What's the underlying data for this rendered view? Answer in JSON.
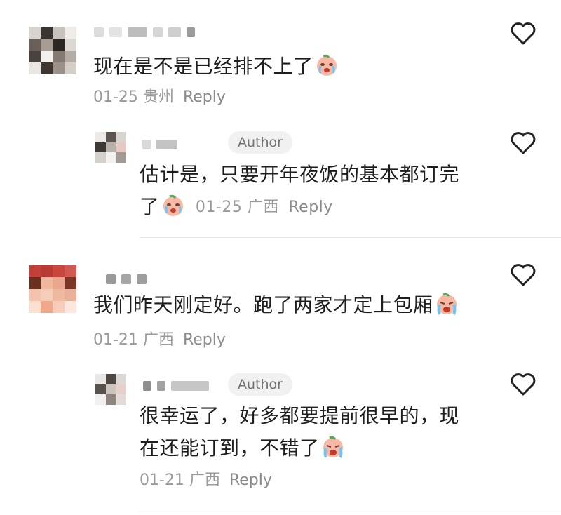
{
  "comments": [
    {
      "text": "现在是不是已经排不上了",
      "date": "01-25",
      "location": "贵州",
      "reply_label": "Reply"
    },
    {
      "badge": "Author",
      "text_line1": "估计是，只要开年夜饭的基本都订完",
      "text_line2": "了",
      "date": "01-25",
      "location": "广西",
      "reply_label": "Reply"
    },
    {
      "text": "我们昨天刚定好。跑了两家才定上包厢",
      "date": "01-21",
      "location": "广西",
      "reply_label": "Reply"
    },
    {
      "badge": "Author",
      "text_line1": "很幸运了，好多都要提前很早的，现",
      "text_line2": "在还能订到，不错了",
      "date": "01-21",
      "location": "广西",
      "reply_label": "Reply"
    }
  ],
  "icons": {
    "like": "heart-outline-icon",
    "emoji_cry": "crying-face-emoji",
    "emoji_sob": "sobbing-face-emoji"
  },
  "colors": {
    "text": "#1e1e1e",
    "meta": "#9a9a9a",
    "badge_bg": "#f1f1f1",
    "heart_stroke": "#222222"
  }
}
